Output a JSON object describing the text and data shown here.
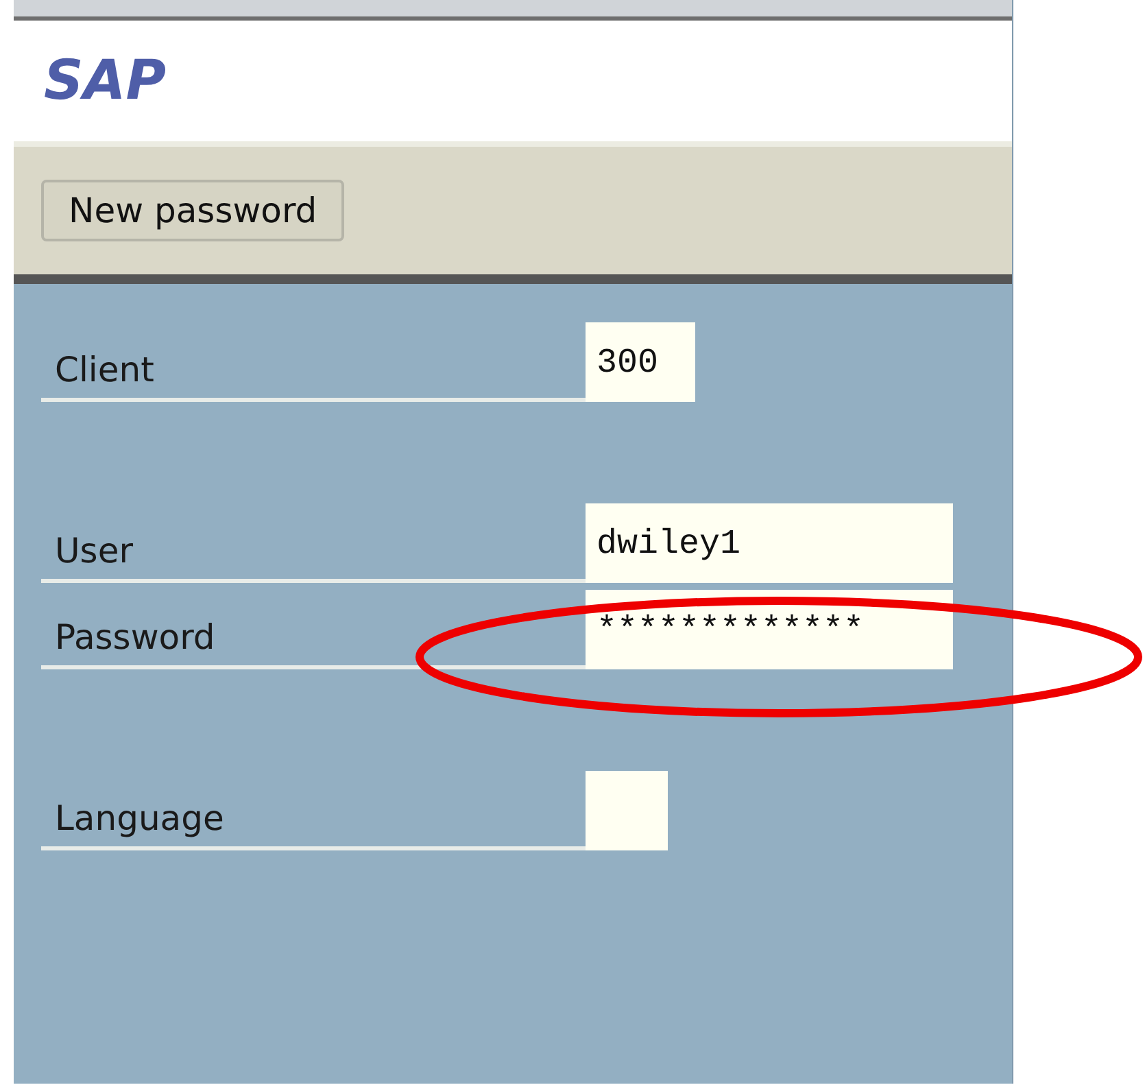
{
  "header": {
    "logo": "SAP"
  },
  "toolbar": {
    "buttons": [
      "New password"
    ]
  },
  "groups": [
    [
      {
        "label": "Client",
        "value": "300",
        "highlighted": false
      }
    ],
    [
      {
        "label": "User",
        "value": "dwiley1",
        "highlighted": false
      },
      {
        "label": "Password",
        "value": "*************",
        "highlighted": true
      }
    ],
    [
      {
        "label": "Language",
        "highlighted": false
      }
    ]
  ]
}
